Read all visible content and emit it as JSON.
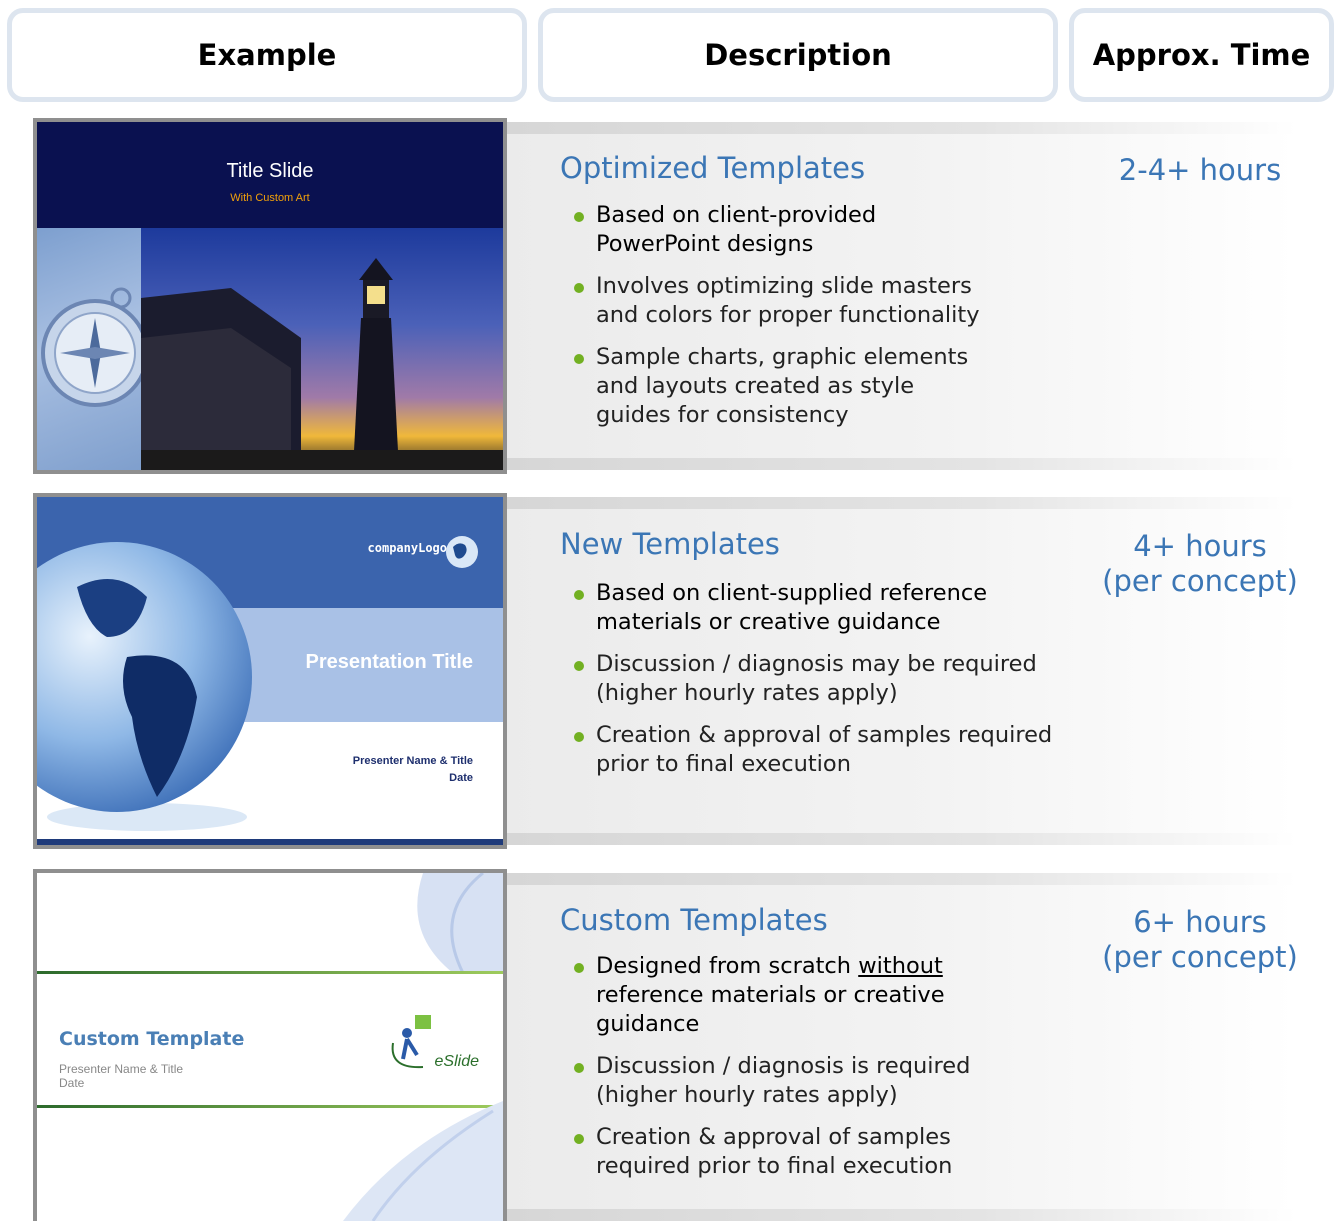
{
  "headers": {
    "example": "Example",
    "description": "Description",
    "time": "Approx. Time"
  },
  "rows": [
    {
      "title": "Optimized Templates",
      "time": "2-4+ hours",
      "time2": "",
      "bullets": [
        "Based on client-provided PowerPoint designs",
        "Involves optimizing slide masters and colors for proper functionality",
        "Sample charts, graphic elements and layouts created as style guides for consistency"
      ],
      "thumb": {
        "title": "Title Slide",
        "subtitle": "With Custom Art"
      }
    },
    {
      "title": "New Templates",
      "time": "4+ hours",
      "time2": "(per concept)",
      "bullets": [
        "Based on client-supplied reference materials or creative guidance",
        "Discussion / diagnosis may be required (higher hourly rates apply)",
        "Creation & approval of samples required prior to final execution"
      ],
      "thumb": {
        "logo": "companyLogo",
        "title": "Presentation Title",
        "presenter": "Presenter Name & Title",
        "date": "Date"
      }
    },
    {
      "title": "Custom Templates",
      "time": "6+ hours",
      "time2": "(per concept)",
      "bullets": [
        {
          "before": "Designed from scratch ",
          "underlined": "without",
          "after": " reference materials or creative guidance"
        },
        "Discussion / diagnosis is required (higher hourly rates apply)",
        "Creation & approval of samples required prior to final execution"
      ],
      "thumb": {
        "title": "Custom Template",
        "presenter": "Presenter Name & Title",
        "date": "Date",
        "logo": "eSlide"
      }
    }
  ]
}
